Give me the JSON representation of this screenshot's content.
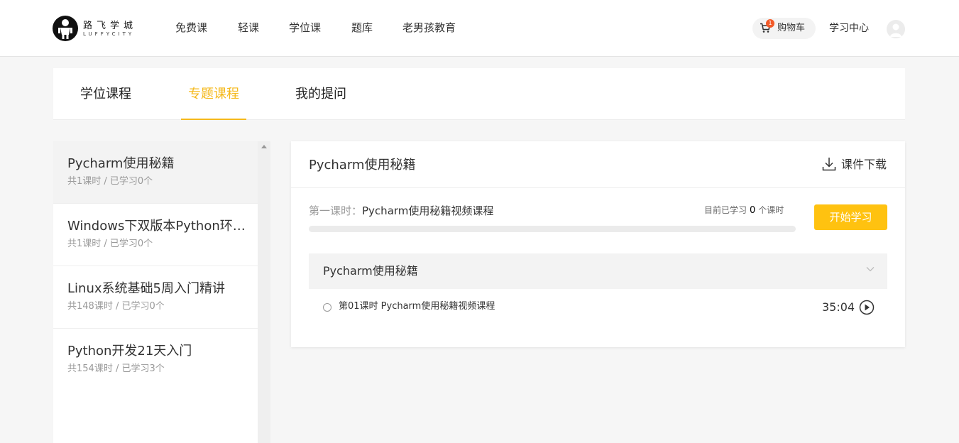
{
  "header": {
    "logo": {
      "cn": "路飞学城",
      "en": "LUFFYCITY"
    },
    "nav": [
      {
        "label": "免费课"
      },
      {
        "label": "轻课"
      },
      {
        "label": "学位课"
      },
      {
        "label": "题库"
      },
      {
        "label": "老男孩教育"
      }
    ],
    "cart": {
      "label": "购物车",
      "count": "1",
      "icon": "cart-icon"
    },
    "study_center": "学习中心",
    "avatar_icon": "user-avatar-icon"
  },
  "tabs": [
    {
      "label": "学位课程",
      "active": false
    },
    {
      "label": "专题课程",
      "active": true
    },
    {
      "label": "我的提问",
      "active": false
    }
  ],
  "sidebar": {
    "courses": [
      {
        "title": "Pycharm使用秘籍",
        "meta": "共1课时 / 已学习0个",
        "active": true
      },
      {
        "title": "Windows下双版本Python环境安装",
        "meta": "共1课时 / 已学习0个",
        "active": false
      },
      {
        "title": "Linux系统基础5周入门精讲",
        "meta": "共148课时 / 已学习0个",
        "active": false
      },
      {
        "title": "Python开发21天入门",
        "meta": "共154课时 / 已学习3个",
        "active": false
      }
    ]
  },
  "panel": {
    "title": "Pycharm使用秘籍",
    "download_label": "课件下载",
    "current_lesson": {
      "prefix": "第一课时：",
      "name": "Pycharm使用秘籍视频课程"
    },
    "progress": {
      "label_before": "目前已学习",
      "count": "0",
      "label_after": "个课时",
      "fraction": 0
    },
    "start_button": "开始学习",
    "chapter": {
      "title": "Pycharm使用秘籍",
      "lessons": [
        {
          "title": "第01课时 Pycharm使用秘籍视频课程",
          "duration": "35:04"
        }
      ]
    }
  },
  "colors": {
    "accent": "#f5b91c",
    "button": "#ffc210",
    "badge": "#f25a29"
  }
}
